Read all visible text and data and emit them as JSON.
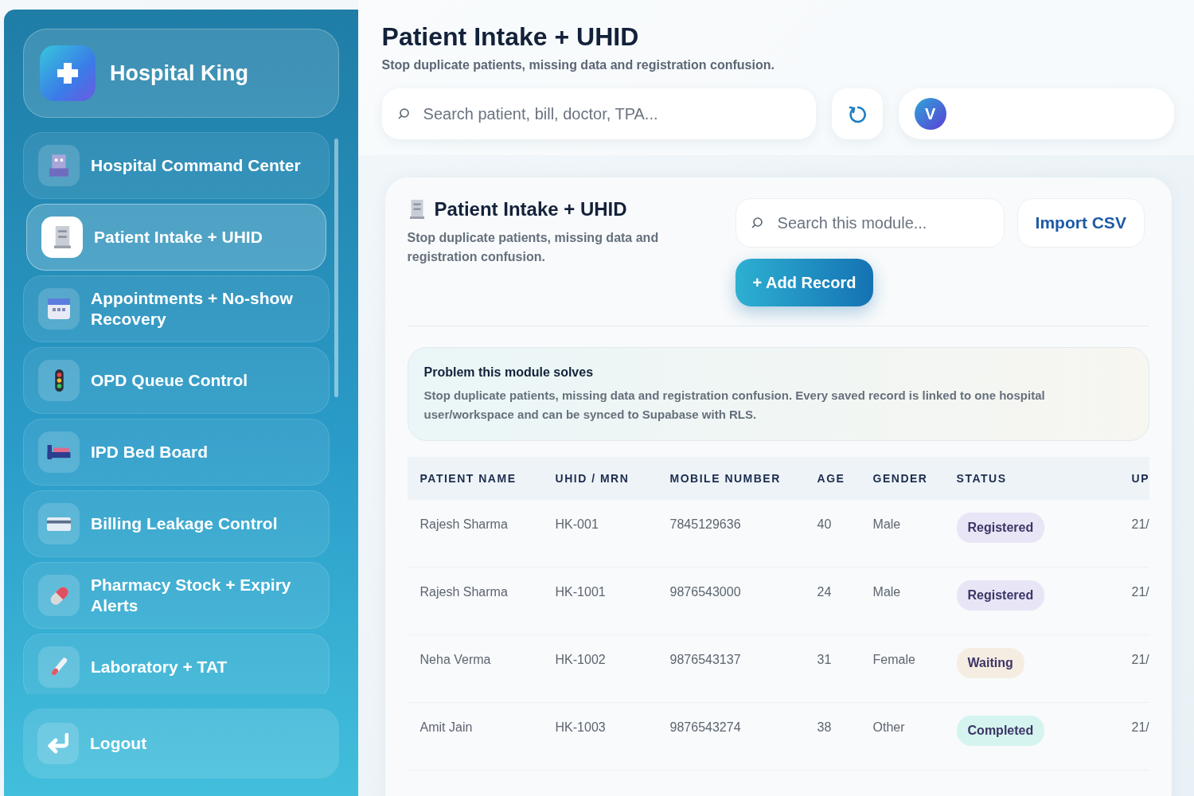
{
  "sidebar": {
    "brand": "Hospital King",
    "items": [
      {
        "label": "Hospital Command Center",
        "selected": false
      },
      {
        "label": "Patient Intake + UHID",
        "selected": true
      },
      {
        "label": "Appointments + No-show Recovery",
        "selected": false
      },
      {
        "label": "OPD Queue Control",
        "selected": false
      },
      {
        "label": "IPD Bed Board",
        "selected": false
      },
      {
        "label": "Billing Leakage Control",
        "selected": false
      },
      {
        "label": "Pharmacy Stock + Expiry Alerts",
        "selected": false
      },
      {
        "label": "Laboratory + TAT",
        "selected": false
      }
    ],
    "logout": "Logout"
  },
  "header": {
    "title": "Patient Intake + UHID",
    "subtitle": "Stop duplicate patients, missing data and registration confusion.",
    "search": {
      "placeholder": "Search patient, bill, doctor, TPA..."
    },
    "avatar": "V"
  },
  "module": {
    "title": "Patient Intake + UHID",
    "description": "Stop duplicate patients, missing data and registration confusion.",
    "search": {
      "placeholder": "Search this module..."
    },
    "import_button": "Import CSV",
    "add_button": "+ Add Record",
    "problem": {
      "title": "Problem this module solves",
      "text": "Stop duplicate patients, missing data and registration confusion. Every saved record is linked to one hospital user/workspace and can be synced to Supabase with RLS."
    },
    "table": {
      "columns": [
        "PATIENT NAME",
        "UHID / MRN",
        "MOBILE NUMBER",
        "AGE",
        "GENDER",
        "STATUS",
        "UP"
      ],
      "rows": [
        {
          "cells": [
            "Rajesh Sharma",
            "HK-001",
            "7845129636",
            "40",
            "Male"
          ],
          "status": "Registered",
          "color": "#e7e5f6",
          "updated": "21/"
        },
        {
          "cells": [
            "Rajesh Sharma",
            "HK-1001",
            "9876543000",
            "24",
            "Male"
          ],
          "status": "Registered",
          "color": "#e7e5f6",
          "updated": "21/"
        },
        {
          "cells": [
            "Neha Verma",
            "HK-1002",
            "9876543137",
            "31",
            "Female"
          ],
          "status": "Waiting",
          "color": "#f6ede2",
          "updated": "21/"
        },
        {
          "cells": [
            "Amit Jain",
            "HK-1003",
            "9876543274",
            "38",
            "Other"
          ],
          "status": "Completed",
          "color": "#d5f4ef",
          "updated": "21/"
        }
      ]
    }
  }
}
